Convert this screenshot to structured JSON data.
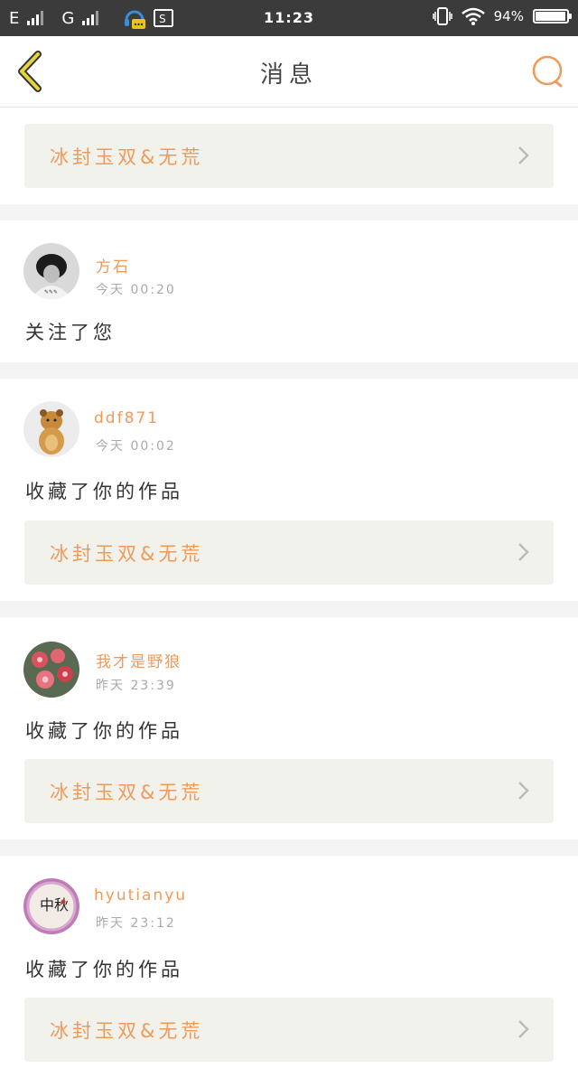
{
  "status_bar": {
    "carrier1": "E",
    "carrier2": "G",
    "time": "11:23",
    "battery": "94"
  },
  "header": {
    "title": "消息",
    "back_icon": "back-arrow-icon",
    "search_icon": "search-icon"
  },
  "colors": {
    "accent": "#f09a5a",
    "back_arrow": "#d6c52a",
    "status_bar": "#3b3b3b"
  },
  "first_card": {
    "work_title": "冰封玉双&无荒"
  },
  "messages": [
    {
      "name": "方石",
      "time_day": "今天",
      "time": "00:20",
      "action": "关注了您"
    },
    {
      "name": "ddf871",
      "time_day": "今天",
      "time": "00:02",
      "action": "收藏了你的作品",
      "work_title": "冰封玉双&无荒"
    },
    {
      "name": "我才是野狼",
      "time_day": "昨天",
      "time": "23:39",
      "action": "收藏了你的作品",
      "work_title": "冰封玉双&无荒"
    },
    {
      "name": "hyutianyu",
      "time_day": "昨天",
      "time": "23:12",
      "action": "收藏了你的作品",
      "work_title": "冰封玉双&无荒"
    }
  ]
}
